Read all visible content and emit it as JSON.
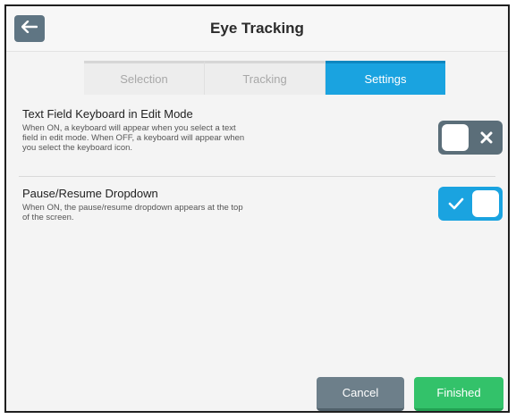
{
  "header": {
    "title": "Eye Tracking",
    "back_icon": "arrow-left-icon"
  },
  "tabs": [
    {
      "label": "Selection",
      "active": false
    },
    {
      "label": "Tracking",
      "active": false
    },
    {
      "label": "Settings",
      "active": true
    }
  ],
  "settings": [
    {
      "name": "Text Field Keyboard in Edit Mode",
      "description": "When ON, a keyboard will appear when you select a text field in edit mode. When OFF, a keyboard will appear when you select the keyboard icon.",
      "state": "off"
    },
    {
      "name": "Pause/Resume Dropdown",
      "description": "When ON, the pause/resume dropdown appears at the top of the screen.",
      "state": "on"
    }
  ],
  "footer": {
    "cancel_label": "Cancel",
    "finished_label": "Finished"
  },
  "colors": {
    "accent": "#1aa3e0",
    "toggle_off": "#5b6e79",
    "success": "#33c26a",
    "neutral_button": "#6d7f8a"
  }
}
